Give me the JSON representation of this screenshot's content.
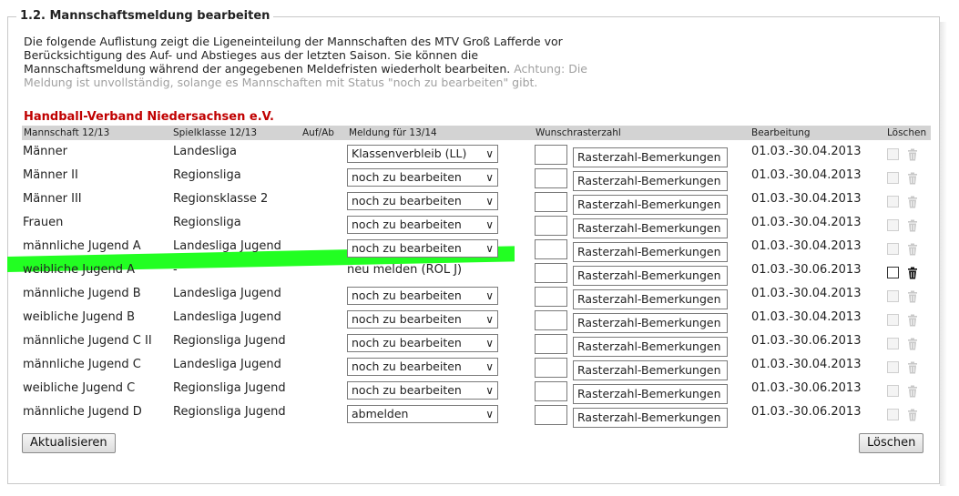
{
  "section": {
    "title": "1.2. Mannschaftsmeldung bearbeiten",
    "intro_lines": [
      "Die folgende Auflistung zeigt die Ligeneinteilung der Mannschaften des MTV Groß Lafferde vor",
      "Berücksichtigung des Auf- und Abstieges aus der letzten Saison. Sie können die",
      "Mannschaftsmeldung während der angegebenen Meldefristen wiederholt bearbeiten."
    ],
    "warning_a": "Achtung: Die",
    "warning_b": "Meldung ist unvollständig, solange es Mannschaften mit Status \"noch zu bearbeiten\" gibt."
  },
  "federation": "Handball-Verband Niedersachsen e.V.",
  "columns": {
    "team": "Mannschaft 12/13",
    "league": "Spielklasse 12/13",
    "updown": "Auf/Ab",
    "meldung": "Meldung für 13/14",
    "wunsch": "Wunschrasterzahl",
    "bearbeitung": "Bearbeitung",
    "loeschen": "Löschen"
  },
  "rows": [
    {
      "team": "Männer",
      "league": "Landesliga",
      "meldung": "Klassenverbleib (LL)",
      "raster": "Rasterzahl-Bemerkungen",
      "period": "01.03.-30.04.2013",
      "deletable": false
    },
    {
      "team": "Männer II",
      "league": "Regionsliga",
      "meldung": "noch zu bearbeiten",
      "raster": "Rasterzahl-Bemerkungen",
      "period": "01.03.-30.04.2013",
      "deletable": false
    },
    {
      "team": "Männer III",
      "league": "Regionsklasse 2",
      "meldung": "noch zu bearbeiten",
      "raster": "Rasterzahl-Bemerkungen",
      "period": "01.03.-30.04.2013",
      "deletable": false
    },
    {
      "team": "Frauen",
      "league": "Regionsliga",
      "meldung": "noch zu bearbeiten",
      "raster": "Rasterzahl-Bemerkungen",
      "period": "01.03.-30.04.2013",
      "deletable": false
    },
    {
      "team": "männliche Jugend A",
      "league": "Landesliga Jugend",
      "meldung": "noch zu bearbeiten",
      "raster": "Rasterzahl-Bemerkungen",
      "period": "01.03.-30.04.2013",
      "deletable": false
    },
    {
      "team": "weibliche Jugend A",
      "league": "-",
      "meldung": "neu melden (ROL J)",
      "raster": "Rasterzahl-Bemerkungen",
      "period": "01.03.-30.06.2013",
      "deletable": true
    },
    {
      "team": "männliche Jugend B",
      "league": "Landesliga Jugend",
      "meldung": "noch zu bearbeiten",
      "raster": "Rasterzahl-Bemerkungen",
      "period": "01.03.-30.04.2013",
      "deletable": false
    },
    {
      "team": "weibliche Jugend B",
      "league": "Landesliga Jugend",
      "meldung": "noch zu bearbeiten",
      "raster": "Rasterzahl-Bemerkungen",
      "period": "01.03.-30.04.2013",
      "deletable": false
    },
    {
      "team": "männliche Jugend C II",
      "league": "Regionsliga Jugend",
      "meldung": "noch zu bearbeiten",
      "raster": "Rasterzahl-Bemerkungen",
      "period": "01.03.-30.06.2013",
      "deletable": false
    },
    {
      "team": "männliche Jugend C",
      "league": "Landesliga Jugend",
      "meldung": "noch zu bearbeiten",
      "raster": "Rasterzahl-Bemerkungen",
      "period": "01.03.-30.04.2013",
      "deletable": false
    },
    {
      "team": "weibliche Jugend C",
      "league": "Regionsliga Jugend",
      "meldung": "noch zu bearbeiten",
      "raster": "Rasterzahl-Bemerkungen",
      "period": "01.03.-30.06.2013",
      "deletable": false
    },
    {
      "team": "männliche Jugend D",
      "league": "Regionsliga Jugend",
      "meldung": "abmelden",
      "raster": "Rasterzahl-Bemerkungen",
      "period": "01.03.-30.06.2013",
      "deletable": false
    }
  ],
  "buttons": {
    "update": "Aktualisieren",
    "delete": "Löschen"
  },
  "icons": {
    "dropdown": "chevron-down-icon",
    "delete": "trash-icon"
  },
  "colors": {
    "federation": "#c00000",
    "highlight": "#22ff22",
    "header_bg": "#d3d3d3",
    "muted_text": "#a0a0a0"
  }
}
